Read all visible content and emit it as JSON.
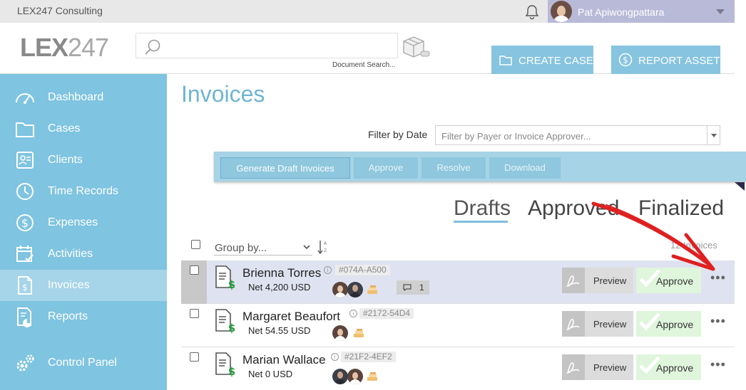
{
  "topbar": {
    "company": "LEX247 Consulting",
    "user_name": "Pat Apiwongpattara"
  },
  "header": {
    "logo_bold": "LEX",
    "logo_thin": "247",
    "search_caption": "Document Search...",
    "create_case": "CREATE CASE",
    "report_asset": "REPORT ASSET"
  },
  "sidebar": {
    "items": [
      {
        "label": "Dashboard",
        "icon": "gauge-icon"
      },
      {
        "label": "Cases",
        "icon": "folder-icon"
      },
      {
        "label": "Clients",
        "icon": "contact-card-icon"
      },
      {
        "label": "Time Records",
        "icon": "clock-icon"
      },
      {
        "label": "Expenses",
        "icon": "dollar-circle-icon"
      },
      {
        "label": "Activities",
        "icon": "calendar-check-icon"
      },
      {
        "label": "Invoices",
        "icon": "invoice-icon",
        "active": true
      },
      {
        "label": "Reports",
        "icon": "report-chart-icon"
      },
      {
        "label": "Control Panel",
        "icon": "gears-icon"
      }
    ]
  },
  "main": {
    "title": "Invoices",
    "filter_label": "Filter by Date",
    "filter_placeholder": "Filter by Payer or Invoice Approver...",
    "actions": {
      "generate": "Generate Draft Invoices",
      "approve": "Approve",
      "resolve": "Resolve",
      "download": "Download"
    },
    "tabs": {
      "drafts": "Drafts",
      "approved": "Approved",
      "finalized": "Finalized"
    },
    "group_by": "Group by...",
    "count": "12 Invoices"
  },
  "rows": [
    {
      "name": "Brienna Torres",
      "code": "#074A-A500",
      "net": "Net 4,200 USD",
      "comments": "1",
      "preview": "Preview",
      "approve": "Approve"
    },
    {
      "name": "Margaret Beaufort",
      "code": "#2172-54D4",
      "net": "Net 54.55 USD",
      "preview": "Preview",
      "approve": "Approve"
    },
    {
      "name": "Marian Wallace",
      "code": "#21F2-4EF2",
      "net": "Net 0 USD",
      "preview": "Preview",
      "approve": "Approve"
    }
  ],
  "colors": {
    "accent": "#7fc4e0",
    "title": "#6fb4d2",
    "approve_bg": "#dff5dc",
    "annotation_arrow": "#e02020"
  }
}
